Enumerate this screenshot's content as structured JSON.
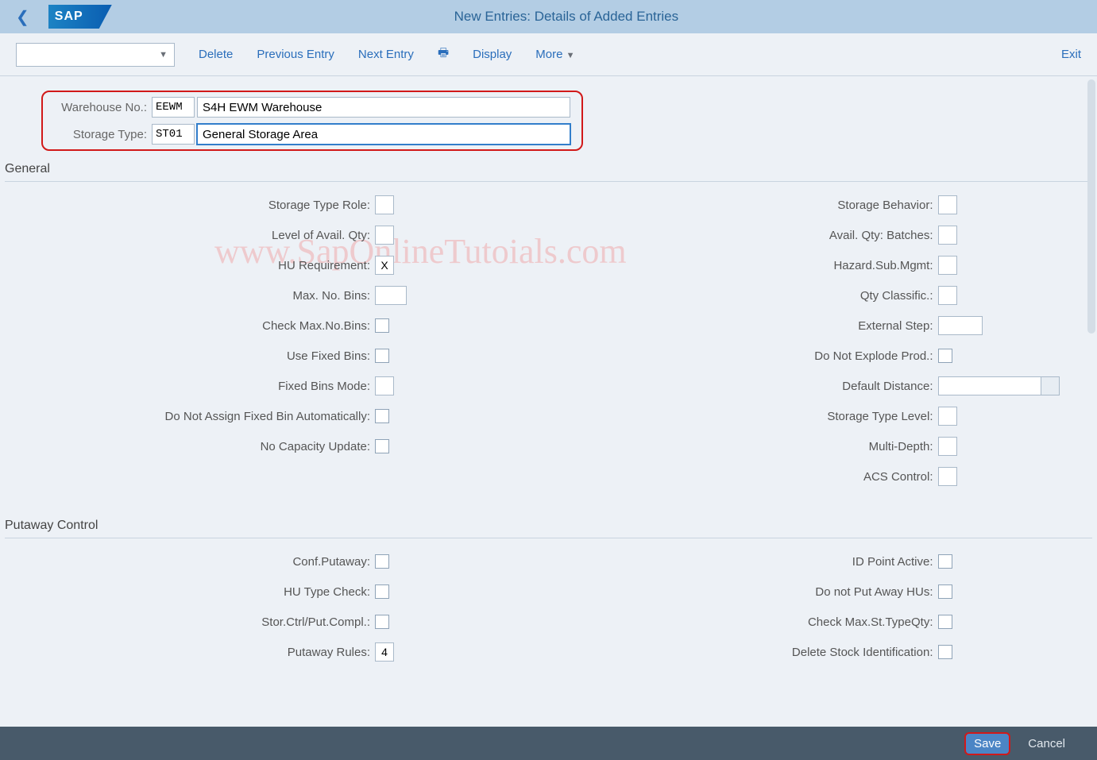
{
  "watermark": "www.SapOnlineTutoials.com",
  "titlebar": {
    "title": "New Entries: Details of Added Entries",
    "logo_text": "SAP"
  },
  "toolbar": {
    "delete": "Delete",
    "prev": "Previous Entry",
    "next": "Next Entry",
    "display": "Display",
    "more": "More",
    "exit": "Exit"
  },
  "header": {
    "warehouse_label": "Warehouse No.:",
    "warehouse_code": "EEWM",
    "warehouse_desc": "S4H EWM Warehouse",
    "storage_type_label": "Storage Type:",
    "storage_type_code": "ST01",
    "storage_type_desc": "General Storage Area"
  },
  "sections": {
    "general": "General",
    "putaway": "Putaway Control"
  },
  "general_left": {
    "storage_type_role": {
      "label": "Storage Type Role:",
      "value": ""
    },
    "level_avail_qty": {
      "label": "Level of Avail. Qty:",
      "value": ""
    },
    "hu_requirement": {
      "label": "HU Requirement:",
      "value": "X"
    },
    "max_no_bins": {
      "label": "Max. No. Bins:",
      "value": ""
    },
    "check_max_bins": {
      "label": "Check Max.No.Bins:"
    },
    "use_fixed_bins": {
      "label": "Use Fixed Bins:"
    },
    "fixed_bins_mode": {
      "label": "Fixed Bins Mode:",
      "value": ""
    },
    "no_auto_fixed_bin": {
      "label": "Do Not Assign Fixed Bin Automatically:"
    },
    "no_capacity_update": {
      "label": "No Capacity Update:"
    }
  },
  "general_right": {
    "storage_behavior": {
      "label": "Storage Behavior:",
      "value": ""
    },
    "avail_qty_batches": {
      "label": "Avail. Qty: Batches:",
      "value": ""
    },
    "hazard_sub_mgmt": {
      "label": "Hazard.Sub.Mgmt:",
      "value": ""
    },
    "qty_classific": {
      "label": "Qty Classific.:",
      "value": ""
    },
    "external_step": {
      "label": "External Step:",
      "value": ""
    },
    "no_explode_prod": {
      "label": "Do Not Explode Prod.:"
    },
    "default_distance": {
      "label": "Default Distance:",
      "value": ""
    },
    "storage_type_level": {
      "label": "Storage Type Level:",
      "value": ""
    },
    "multi_depth": {
      "label": "Multi-Depth:",
      "value": ""
    },
    "acs_control": {
      "label": "ACS Control:",
      "value": ""
    }
  },
  "putaway_left": {
    "conf_putaway": {
      "label": "Conf.Putaway:"
    },
    "hu_type_check": {
      "label": "HU Type Check:"
    },
    "stor_ctrl_put_compl": {
      "label": "Stor.Ctrl/Put.Compl.:"
    },
    "putaway_rules": {
      "label": "Putaway Rules:",
      "value": "4"
    }
  },
  "putaway_right": {
    "id_point_active": {
      "label": "ID Point Active:"
    },
    "no_put_away_hus": {
      "label": "Do not Put Away HUs:"
    },
    "check_max_st_typeqty": {
      "label": "Check Max.St.TypeQty:"
    },
    "delete_stock_id": {
      "label": "Delete Stock Identification:"
    }
  },
  "footer": {
    "save": "Save",
    "cancel": "Cancel"
  }
}
